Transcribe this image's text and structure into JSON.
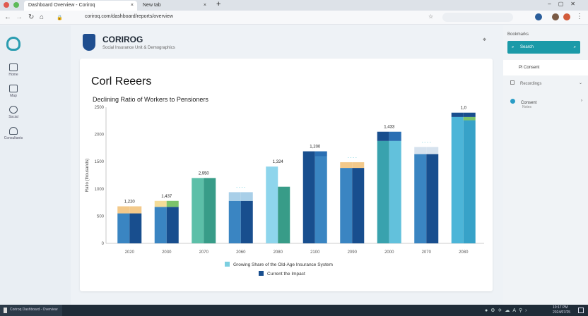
{
  "browser": {
    "tabs": [
      {
        "label": "Dashboard Overview - Coriroq"
      },
      {
        "label": "New tab"
      }
    ],
    "url": "coriroq.com/dashboard/reports/overview",
    "new_tab": "+"
  },
  "header": {
    "brand": "CORIROG",
    "subtitle": "Social Insurance Unit & Demographics",
    "settings_icon": "⌖"
  },
  "sidebar": {
    "items": [
      {
        "label": "Home",
        "icon": "home-icon"
      },
      {
        "label": "Map",
        "icon": "map-icon"
      },
      {
        "label": "Social",
        "icon": "social-icon"
      },
      {
        "label": "Consultants",
        "icon": "consultant-icon"
      }
    ]
  },
  "card": {
    "title": "Corl Reeers"
  },
  "right_panel": {
    "section_label": "Bookmarks",
    "search_label": "Search",
    "items": [
      {
        "label": "Pi Consent"
      },
      {
        "label": "Recordings"
      },
      {
        "label": "Consent",
        "sub": "Notes"
      }
    ]
  },
  "taskbar": {
    "app_label": "Coriroq Dashboard - Overview",
    "time": "10:17 PM",
    "date": "2024/07/25"
  },
  "chart_data": {
    "type": "bar",
    "title": "Declining Ratio of Workers to Pensioners",
    "ylabel": "Ratio (thousands)",
    "xlabel": "",
    "ylim": [
      0,
      2500
    ],
    "yticks": [
      0,
      500,
      1000,
      1500,
      2000,
      2500
    ],
    "ytick_labels": [
      "0",
      "500",
      "1000",
      "1500",
      "2000",
      "2500"
    ],
    "grid": false,
    "categories": [
      "2020",
      "2030",
      "2070",
      "2060",
      "2080",
      "2100",
      "2090",
      "2000",
      "2070",
      "2080"
    ],
    "data_labels": [
      "1,220",
      "1,437",
      "2,950",
      "- - - -",
      "1,324",
      "1,200",
      "- - - -",
      "1,433",
      "- - - -",
      "1,0"
    ],
    "groups": [
      {
        "left": [
          [
            550,
            "#3a85c2"
          ],
          [
            130,
            "#f3c98a"
          ]
        ],
        "right": [
          [
            550,
            "#184e8e"
          ],
          [
            130,
            "#f3c98a"
          ]
        ]
      },
      {
        "left": [
          [
            670,
            "#3a85c2"
          ],
          [
            110,
            "#f4dc98"
          ]
        ],
        "right": [
          [
            670,
            "#184e8e"
          ],
          [
            110,
            "#7cc36a"
          ]
        ]
      },
      {
        "left": [
          [
            1200,
            "#5cbfa8"
          ]
        ],
        "right": [
          [
            1200,
            "#389c88"
          ]
        ]
      },
      {
        "left": [
          [
            780,
            "#3a85c2"
          ],
          [
            160,
            "#a9cfe8"
          ]
        ],
        "right": [
          [
            780,
            "#184e8e"
          ],
          [
            160,
            "#a9cfe8"
          ]
        ]
      },
      {
        "left": [
          [
            1410,
            "#8ed5ec"
          ]
        ],
        "right": [
          [
            1040,
            "#389c88"
          ]
        ]
      },
      {
        "left": [
          [
            1690,
            "#184e8e"
          ]
        ],
        "right": [
          [
            1600,
            "#3a85c2"
          ],
          [
            90,
            "#2a6fb3"
          ]
        ]
      },
      {
        "left": [
          [
            1385,
            "#3a85c2"
          ],
          [
            105,
            "#f3c98a"
          ]
        ],
        "right": [
          [
            1385,
            "#184e8e"
          ],
          [
            105,
            "#f3c98a"
          ]
        ]
      },
      {
        "left": [
          [
            1880,
            "#39a2ae"
          ],
          [
            170,
            "#184e8e"
          ]
        ],
        "right": [
          [
            1880,
            "#62c1dc"
          ],
          [
            170,
            "#2a6fb3"
          ]
        ]
      },
      {
        "left": [
          [
            1640,
            "#3a85c2"
          ],
          [
            130,
            "#d6e2ee"
          ]
        ],
        "right": [
          [
            1640,
            "#184e8e"
          ],
          [
            130,
            "#d6e2ee"
          ]
        ]
      },
      {
        "left": [
          [
            2320,
            "#4cb5d8"
          ],
          [
            80,
            "#184e8e"
          ]
        ],
        "right": [
          [
            2260,
            "#37a2c8"
          ],
          [
            60,
            "#7cc36a"
          ],
          [
            80,
            "#184e8e"
          ]
        ]
      }
    ],
    "legend": [
      {
        "label": "Growing Share of the Old-Age Insurance System",
        "color": "#7ccfe0"
      },
      {
        "label": "Current the Impact",
        "color": "#184e8e"
      }
    ],
    "legend_position": "bottom-center"
  }
}
